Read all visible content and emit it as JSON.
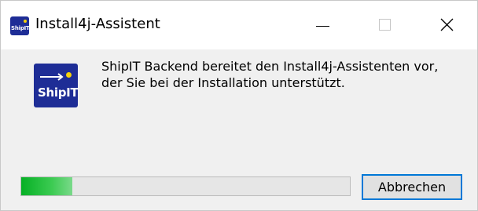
{
  "window": {
    "title": "Install4j-Assistent",
    "icon_text": "ShipIT",
    "controls": {
      "minimize_icon": "minimize-icon",
      "maximize_icon": "maximize-icon",
      "close_icon": "close-icon"
    }
  },
  "logo": {
    "text": "ShipIT",
    "background": "#1e2d96",
    "accent": "#f5d20a"
  },
  "message": {
    "line1": "ShipIT Backend bereitet den Install4j-Assistenten vor,",
    "line2": "der Sie bei der Installation unterstützt."
  },
  "progress": {
    "value_fraction": 0.155,
    "color": "#06b025"
  },
  "cancel_button": {
    "label": "Abbrechen",
    "focus_color": "#0078d7"
  }
}
